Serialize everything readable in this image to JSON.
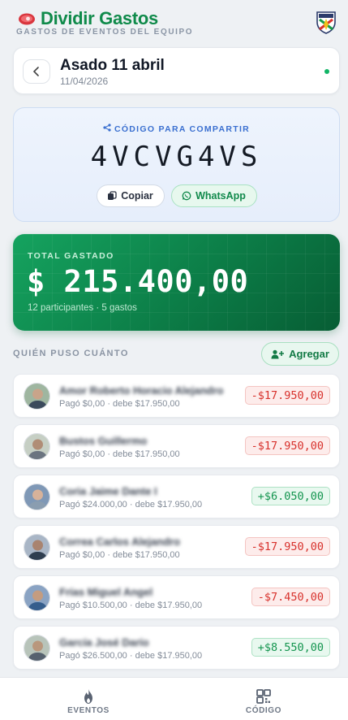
{
  "header": {
    "app_title": "Dividir Gastos",
    "subtitle": "GASTOS DE EVENTOS DEL EQUIPO",
    "logo_icon": "steak-icon",
    "crest_icon": "club-crest-icon"
  },
  "event": {
    "title": "Asado 11 abril",
    "date": "11/04/2026",
    "back_icon": "chevron-left-icon",
    "status_color": "#12b566"
  },
  "share": {
    "label": "CÓDIGO PARA COMPARTIR",
    "code": "4VCVG4VS",
    "copy_label": "Copiar",
    "whatsapp_label": "WhatsApp"
  },
  "total": {
    "label": "TOTAL GASTADO",
    "amount": "$ 215.400,00",
    "meta": "12 participantes · 5 gastos"
  },
  "participants_section": {
    "title": "QUIÉN PUSO CUÁNTO",
    "add_label": "Agregar"
  },
  "participants": [
    {
      "name": "Amor Roberto Horacio Alejandro",
      "detail": "Pagó $0,00 · debe $17.950,00",
      "balance": "-$17.950,00",
      "positive": false
    },
    {
      "name": "Bustos Guillermo",
      "detail": "Pagó $0,00 · debe $17.950,00",
      "balance": "-$17.950,00",
      "positive": false
    },
    {
      "name": "Coria Jaime Dante I",
      "detail": "Pagó $24.000,00 · debe $17.950,00",
      "balance": "+$6.050,00",
      "positive": true
    },
    {
      "name": "Correa Carlos Alejandro",
      "detail": "Pagó $0,00 · debe $17.950,00",
      "balance": "-$17.950,00",
      "positive": false
    },
    {
      "name": "Frías Miguel Angel",
      "detail": "Pagó $10.500,00 · debe $17.950,00",
      "balance": "-$7.450,00",
      "positive": false
    },
    {
      "name": "García José Darío",
      "detail": "Pagó $26.500,00 · debe $17.950,00",
      "balance": "+$8.550,00",
      "positive": true
    }
  ],
  "nav": {
    "events_label": "EVENTOS",
    "code_label": "CÓDIGO"
  },
  "colors": {
    "brand_green": "#0f8a4a",
    "accent_blue": "#3a6fd0",
    "negative_red": "#d8322d",
    "positive_green": "#14954f"
  }
}
